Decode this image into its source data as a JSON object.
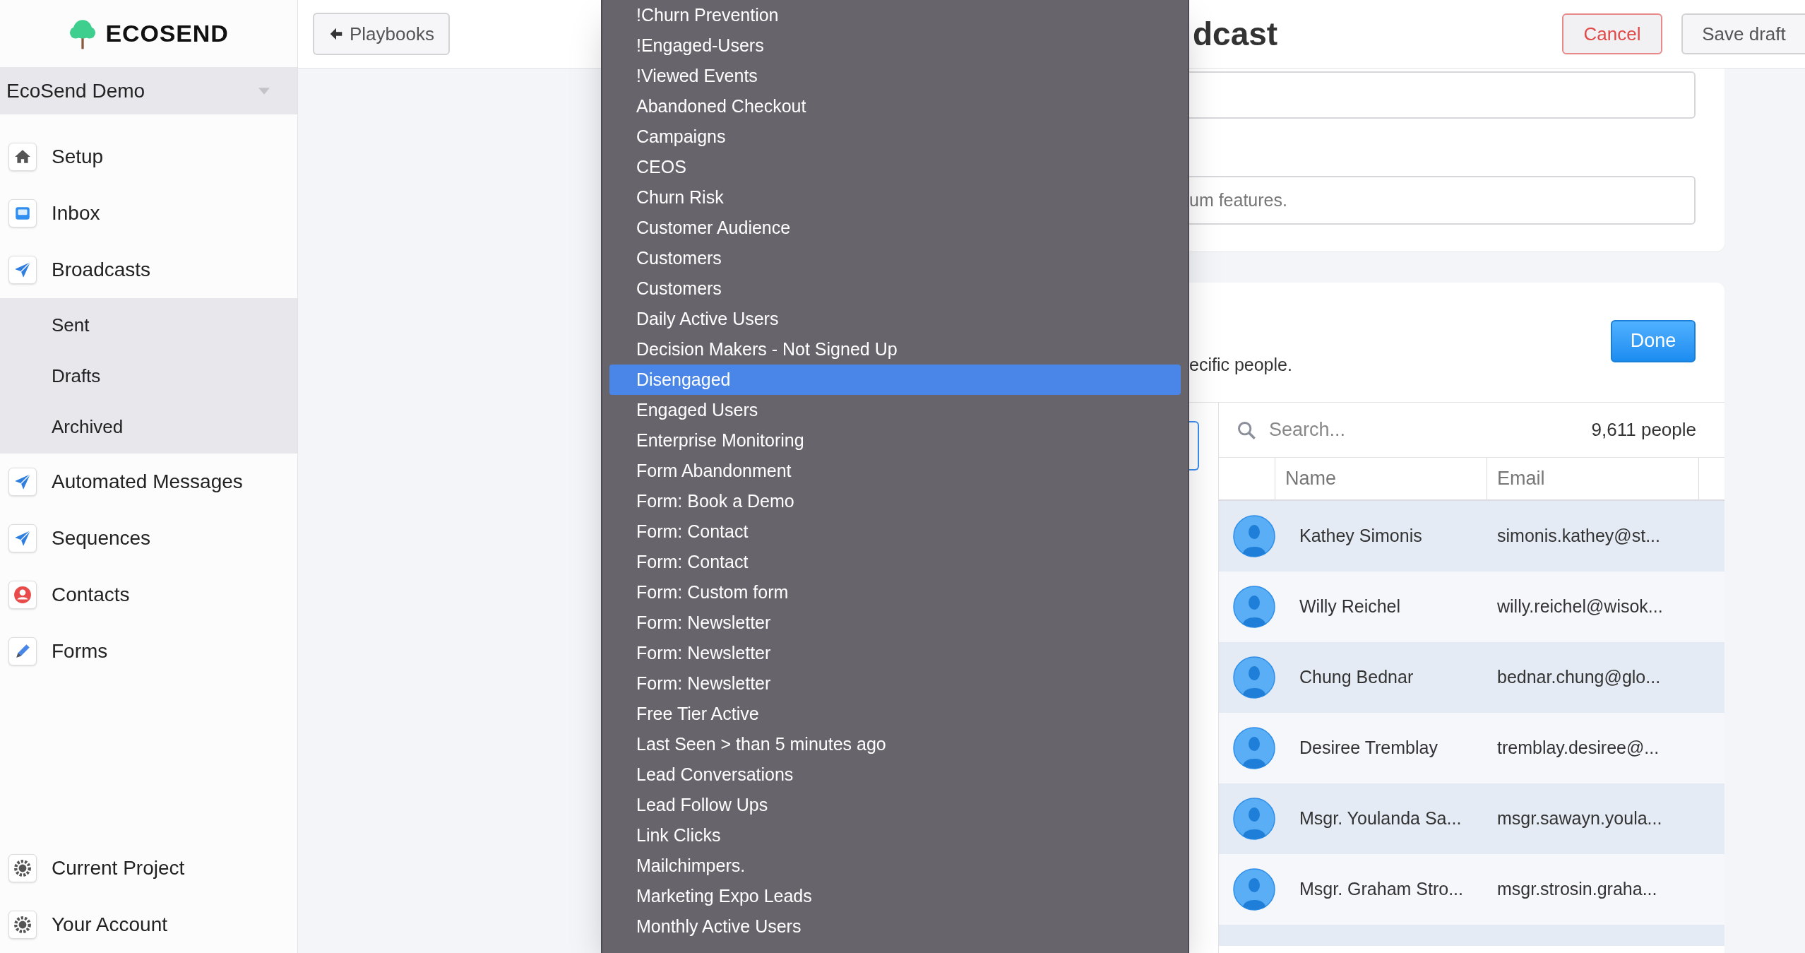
{
  "sidebar": {
    "brand": "ECOSEND",
    "project": "EcoSend Demo",
    "items": [
      {
        "label": "Setup"
      },
      {
        "label": "Inbox"
      },
      {
        "label": "Broadcasts",
        "children": [
          {
            "label": "Sent"
          },
          {
            "label": "Drafts"
          },
          {
            "label": "Archived"
          }
        ]
      },
      {
        "label": "Automated Messages"
      },
      {
        "label": "Sequences"
      },
      {
        "label": "Contacts"
      },
      {
        "label": "Forms"
      }
    ],
    "footer_items": [
      {
        "label": "Current Project"
      },
      {
        "label": "Your Account"
      }
    ]
  },
  "top_bar": {
    "back_button": "Playbooks",
    "title": "dcast",
    "cancel_button": "Cancel",
    "save_button": "Save draft"
  },
  "form": {
    "field_2_placeholder": "um features."
  },
  "recipients": {
    "text": "ecific people.",
    "done_button": "Done",
    "search": {
      "placeholder": "Search..."
    },
    "count": "9,611 people",
    "columns": [
      "Name",
      "Email"
    ],
    "rows": [
      {
        "name": "Kathey Simonis",
        "email": "simonis.kathey@st..."
      },
      {
        "name": "Willy Reichel",
        "email": "willy.reichel@wisok..."
      },
      {
        "name": "Chung Bednar",
        "email": "bednar.chung@glo..."
      },
      {
        "name": "Desiree Tremblay",
        "email": "tremblay.desiree@..."
      },
      {
        "name": "Msgr. Youlanda Sa...",
        "email": "msgr.sawayn.youla..."
      },
      {
        "name": "Msgr. Graham Stro...",
        "email": "msgr.strosin.graha..."
      }
    ]
  },
  "dropdown": {
    "items": [
      {
        "label": "!Churn Prevention",
        "selected": false
      },
      {
        "label": "!Engaged-Users",
        "selected": false
      },
      {
        "label": "!Viewed Events",
        "selected": false
      },
      {
        "label": "Abandoned Checkout",
        "selected": false
      },
      {
        "label": "Campaigns",
        "selected": false
      },
      {
        "label": "CEOS",
        "selected": false
      },
      {
        "label": "Churn Risk",
        "selected": false
      },
      {
        "label": "Customer Audience",
        "selected": false
      },
      {
        "label": "Customers",
        "selected": false
      },
      {
        "label": "Customers",
        "selected": false
      },
      {
        "label": "Daily Active Users",
        "selected": false
      },
      {
        "label": "Decision Makers - Not Signed Up",
        "selected": false
      },
      {
        "label": "Disengaged",
        "selected": true
      },
      {
        "label": "Engaged Users",
        "selected": false
      },
      {
        "label": "Enterprise Monitoring",
        "selected": false
      },
      {
        "label": "Form Abandonment",
        "selected": false
      },
      {
        "label": "Form: Book a Demo",
        "selected": false
      },
      {
        "label": "Form: Contact",
        "selected": false
      },
      {
        "label": "Form: Contact",
        "selected": false
      },
      {
        "label": "Form: Custom form",
        "selected": false
      },
      {
        "label": "Form: Newsletter",
        "selected": false
      },
      {
        "label": "Form: Newsletter",
        "selected": false
      },
      {
        "label": "Form: Newsletter",
        "selected": false
      },
      {
        "label": "Free Tier Active",
        "selected": false
      },
      {
        "label": "Last Seen > than 5 minutes ago",
        "selected": false
      },
      {
        "label": "Lead Conversations",
        "selected": false
      },
      {
        "label": "Lead Follow Ups",
        "selected": false
      },
      {
        "label": "Link Clicks",
        "selected": false
      },
      {
        "label": "Mailchimpers.",
        "selected": false
      },
      {
        "label": "Marketing Expo Leads",
        "selected": false
      },
      {
        "label": "Monthly Active Users",
        "selected": false
      }
    ]
  }
}
